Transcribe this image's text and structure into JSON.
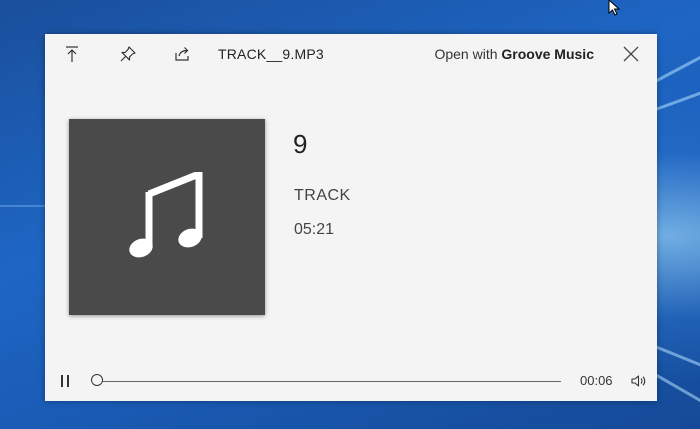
{
  "window": {
    "title": "TRACK__9.MP3",
    "open_with_prefix": "Open with ",
    "open_with_app": "Groove Music"
  },
  "toolbar": {
    "icons": [
      "collapse-to-top-icon",
      "pin-icon",
      "share-icon",
      "close-icon"
    ]
  },
  "track": {
    "number": "9",
    "name": "TRACK",
    "duration": "05:21",
    "album_art_icon": "music-note-icon"
  },
  "playback": {
    "state": "playing",
    "elapsed": "00:06",
    "progress_fraction": 0.0,
    "play_pause_icon": "pause-icon",
    "volume_icon": "volume-icon"
  },
  "colors": {
    "window_bg": "#f4f4f4",
    "album_art_bg": "#4a4a4a",
    "desktop_bg": "#1e66c4"
  }
}
